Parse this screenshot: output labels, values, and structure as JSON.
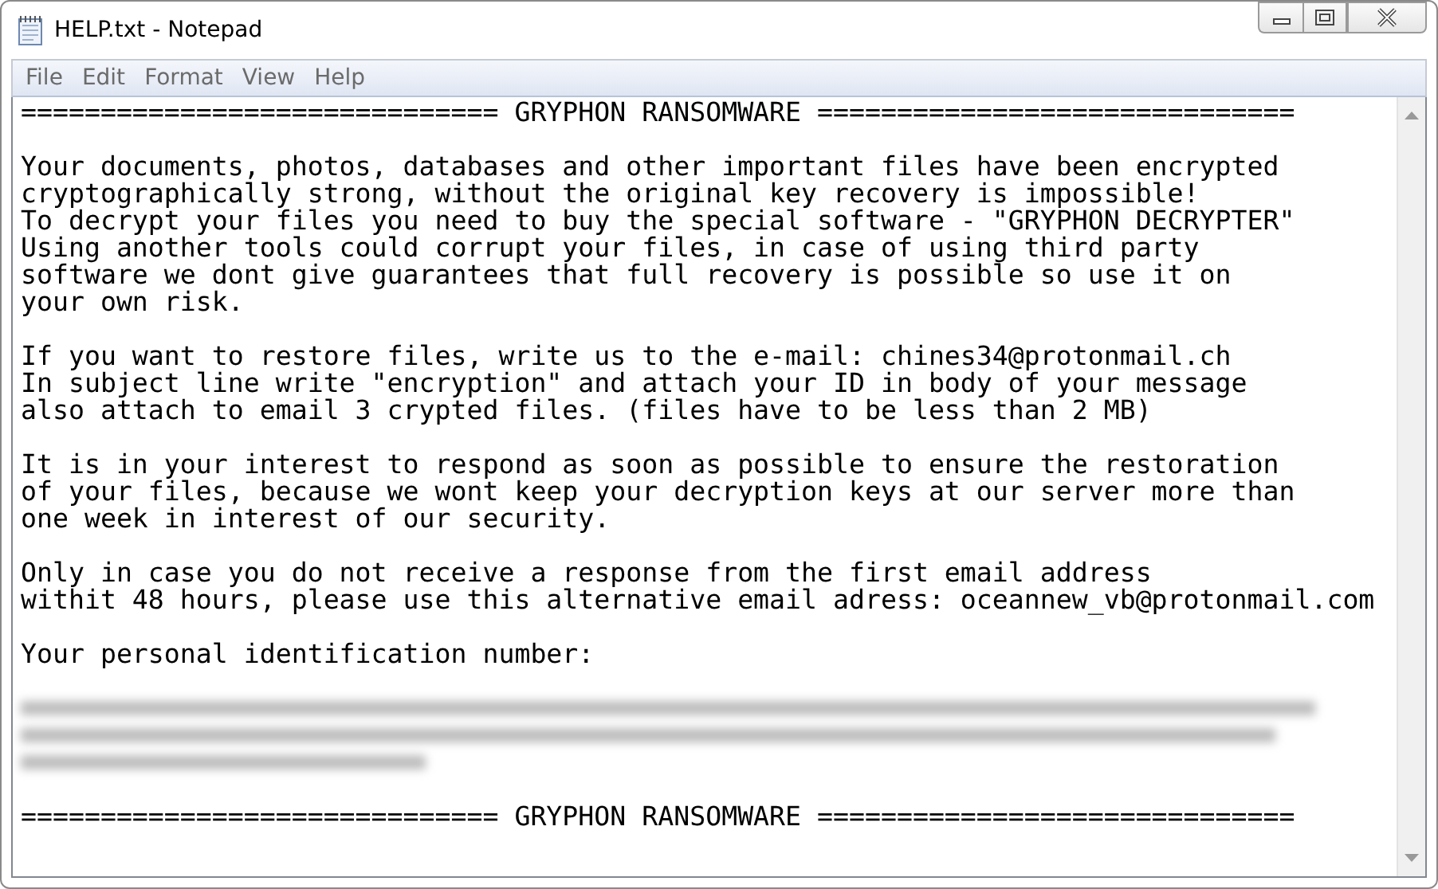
{
  "window": {
    "title": "HELP.txt - Notepad"
  },
  "menu": [
    "File",
    "Edit",
    "Format",
    "View",
    "Help"
  ],
  "document": {
    "header": "============================== GRYPHON RANSOMWARE ==============================",
    "paragraphs": [
      [
        "Your documents, photos, databases and other important files have been encrypted",
        "cryptographically strong, without the original key recovery is impossible!",
        "To decrypt your files you need to buy the special software - \"GRYPHON DECRYPTER\"",
        "Using another tools could corrupt your files, in case of using third party",
        "software we dont give guarantees that full recovery is possible so use it on",
        "your own risk."
      ],
      [
        "If you want to restore files, write us to the e-mail: chines34@protonmail.ch",
        "In subject line write \"encryption\" and attach your ID in body of your message",
        "also attach to email 3 crypted files. (files have to be less than 2 MB)"
      ],
      [
        "It is in your interest to respond as soon as possible to ensure the restoration",
        "of your files, because we wont keep your decryption keys at our server more than",
        "one week in interest of our security."
      ],
      [
        "Only in case you do not receive a response from the first email address",
        "withit 48 hours, please use this alternative email adress: oceannew_vb@protonmail.com"
      ],
      [
        "Your personal identification number:"
      ]
    ],
    "id_redacted": true,
    "footer": "============================== GRYPHON RANSOMWARE =============================="
  }
}
